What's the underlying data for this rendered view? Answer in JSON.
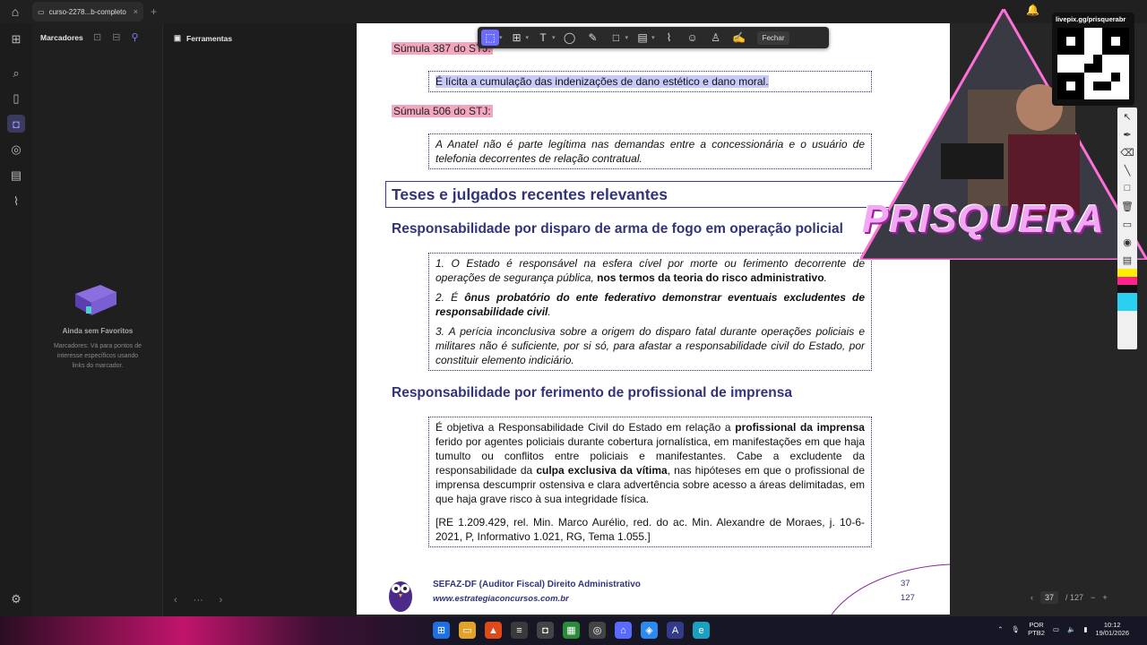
{
  "titlebar": {
    "tab_title": "curso-2278...b-completo",
    "tab_close": "×",
    "new_tab": "+"
  },
  "sidebar": {
    "title": "Marcadores",
    "empty_title": "Ainda sem Favoritos",
    "empty_desc": "Marcadores: Vá para pontos de interesse específicos usando links do marcador."
  },
  "tools_panel": {
    "title": "Ferramentas"
  },
  "toolbar": {
    "close_label": "Fechar"
  },
  "document": {
    "sumula_387_title": "Súmula 387 do STJ:",
    "sumula_387_text": "É lícita a cumulação das indenizações de dano estético e dano moral.",
    "sumula_506_title": "Súmula 506 do STJ:",
    "sumula_506_text": "A Anatel não é parte legítima nas demandas entre a concessionária e o usuário de telefonia decorrentes de relação contratual.",
    "section_title": "Teses e julgados recentes relevantes",
    "sub1_title": "Responsabilidade por disparo de arma de fogo em operação policial",
    "item1_a": "1. O Estado é responsável na esfera cível por morte ou ferimento decorrente de operações de segurança pública, ",
    "item1_b": "nos termos da teoria do risco administrativo",
    "item1_c": ".",
    "item2_a": "2. É ",
    "item2_b": "ônus probatório do ente federativo demonstrar eventuais excludentes de responsabilidade civil",
    "item2_c": ".",
    "item3": "3. A perícia inconclusiva sobre a origem do disparo fatal durante operações policiais e militares não é suficiente, por si só, para afastar a responsabilidade civil do Estado, por constituir elemento indiciário.",
    "sub2_title": "Responsabilidade por ferimento de profissional de imprensa",
    "p2_a": "É objetiva a Responsabilidade Civil do Estado em relação a ",
    "p2_b": "profissional da imprensa",
    "p2_c": " ferido por agentes policiais durante cobertura jornalística, em manifestações em que haja tumulto ou conflitos entre policiais e manifestantes. Cabe a excludente da responsabilidade da ",
    "p2_d": "culpa exclusiva da vítima",
    "p2_e": ", nas hipóteses em que o profissional de imprensa descumprir ostensiva e clara advertência sobre acesso a áreas delimitadas, em que haja grave risco à sua integridade física.",
    "p2_ref": "[RE 1.209.429, rel. Min. Marco Aurélio, red. do ac. Min. Alexandre de Moraes, j. 10-6-2021, P, Informativo 1.021, RG, Tema 1.055.]",
    "footer_line1": "SEFAZ-DF (Auditor Fiscal) Direito Administrativo",
    "footer_line2": "www.estrategiaconcursos.com.br",
    "page_current_print": "37",
    "page_total_print": "127"
  },
  "pager": {
    "current": "37",
    "total": "/ 127"
  },
  "stream": {
    "qr_label": "livepix.gg/prisquerabr",
    "brand": "PRISQUERA"
  },
  "taskbar": {
    "lang1": "POR",
    "lang2": "PTB2",
    "time": "10:12",
    "date": "19/01/2026"
  },
  "colors": {
    "accent": "#6b6bff",
    "highlight_pink": "#f3a6bd",
    "heading_navy": "#33337a"
  }
}
